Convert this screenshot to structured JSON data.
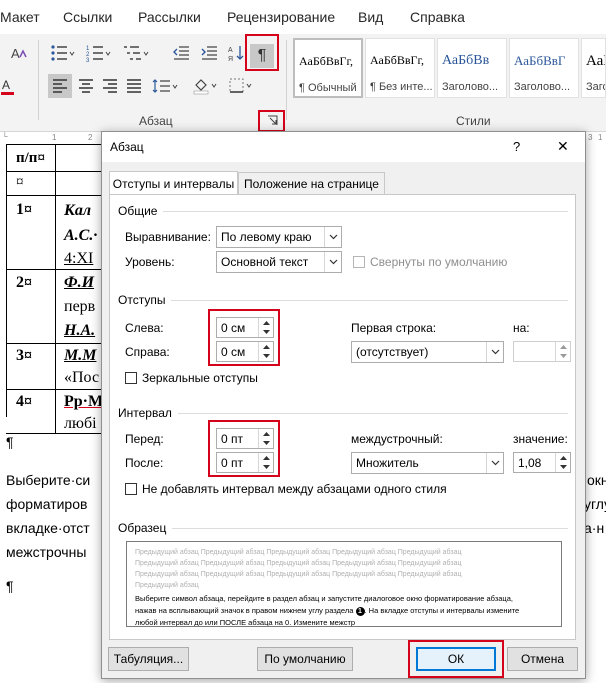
{
  "menu": {
    "items": [
      "Макет",
      "Ссылки",
      "Рассылки",
      "Рецензирование",
      "Вид",
      "Справка"
    ]
  },
  "ribbon": {
    "paragraph_group_label": "Абзац",
    "styles_group_label": "Стили",
    "styles": [
      {
        "sample": "АаБбВвГг,",
        "name": "¶ Обычный",
        "selected": true
      },
      {
        "sample": "АаБбВвГг,",
        "name": "¶ Без инте...",
        "selected": false
      },
      {
        "sample": "АаБбВв",
        "name": "Заголово...",
        "selected": false
      },
      {
        "sample": "АаБбВвГ",
        "name": "Заголово...",
        "selected": false
      },
      {
        "sample": "АаБб",
        "name": "Заго",
        "selected": false
      }
    ],
    "pilcrow_button": "¶",
    "colors": {
      "highlight_red": "#d5021c",
      "accent": "#0078d7"
    }
  },
  "ruler": {
    "marks": [
      "1",
      "2",
      "3",
      "1"
    ]
  },
  "document": {
    "table_header": [
      "п/п¤",
      "¤"
    ],
    "rows": [
      {
        "num": "1¤",
        "lines": [
          "Кал",
          "А.С.·",
          "4:XI"
        ]
      },
      {
        "num": "2¤",
        "lines": [
          "Ф.И",
          "перв",
          "Н.А."
        ]
      },
      {
        "num": "3¤",
        "lines": [
          "М.М",
          "«Пос"
        ]
      },
      {
        "num": "4¤",
        "lines": [
          "Рр·М",
          "любі"
        ]
      }
    ],
    "after_table": "¶",
    "paragraph_lines": [
      {
        "left": "Выберите·си",
        "right": "окн"
      },
      {
        "left": "форматиров",
        "right": "углу"
      },
      {
        "left": "вкладке·отст",
        "right": "а·н"
      },
      {
        "left": "межстрочны",
        "right": ""
      }
    ],
    "pilcrow": "¶"
  },
  "dialog": {
    "title": "Абзац",
    "help": "?",
    "close": "✕",
    "tabs": [
      {
        "label": "Отступы и интервалы",
        "active": true
      },
      {
        "label": "Положение на странице",
        "active": false
      }
    ],
    "general": {
      "title": "Общие",
      "alignment_label": "Выравнивание:",
      "alignment_value": "По левому краю",
      "level_label": "Уровень:",
      "level_value": "Основной текст",
      "collapsed_label": "Свернуты по умолчанию"
    },
    "indents": {
      "title": "Отступы",
      "left_label": "Слева:",
      "left_value": "0 см",
      "right_label": "Справа:",
      "right_value": "0 см",
      "first_line_label": "Первая строка:",
      "first_line_value": "(отсутствует)",
      "by_label": "на:",
      "by_value": "",
      "mirror_label": "Зеркальные отступы"
    },
    "spacing": {
      "title": "Интервал",
      "before_label": "Перед:",
      "before_value": "0 пт",
      "after_label": "После:",
      "after_value": "0 пт",
      "line_label": "междустрочный:",
      "line_value": "Множитель",
      "at_label": "значение:",
      "at_value": "1,08",
      "no_space_label": "Не добавлять интервал между абзацами одного стиля"
    },
    "preview": {
      "title": "Образец",
      "previous_lines": [
        "Предыдущий абзац Предыдущий абзац Предыдущий абзац Предыдущий абзац Предыдущий абзац",
        "Предыдущий абзац Предыдущий абзац Предыдущий абзац Предыдущий абзац Предыдущий абзац",
        "Предыдущий абзац Предыдущий абзац Предыдущий абзац Предыдущий абзац Предыдущий абзац",
        "Предыдущий абзац"
      ],
      "current_lines": [
        "Выберите символ абзаца, перейдите в раздел абзац и запустите диалоговое окно форматирование абзаца,",
        "нажав на всплывающий значок в правом нижнем углу раздела",
        ". На вкладке отступы и интервалы измените",
        "любой интервал до или ПОСЛЕ абзаца на 0. Измените межстр"
      ],
      "marker": "1"
    },
    "buttons": {
      "tabs": "Табуляция...",
      "default": "По умолчанию",
      "ok": "ОК",
      "cancel": "Отмена"
    }
  }
}
